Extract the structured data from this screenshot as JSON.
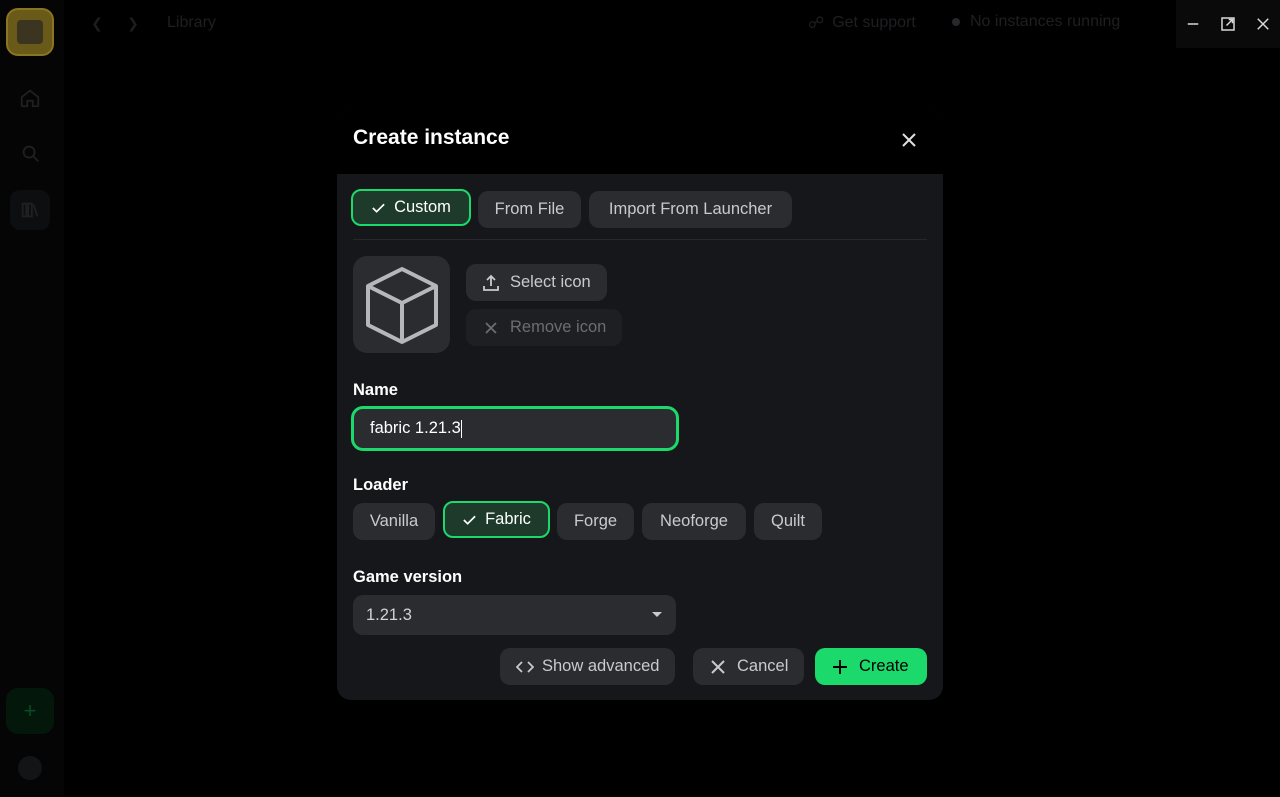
{
  "app": {
    "breadcrumb": "Library",
    "support_label": "Get support",
    "instances_status": "No instances running"
  },
  "modal": {
    "title": "Create instance",
    "tabs": [
      {
        "label": "Custom",
        "selected": true
      },
      {
        "label": "From File",
        "selected": false
      },
      {
        "label": "Import From Launcher",
        "selected": false
      }
    ],
    "icon": {
      "preview_icon": "cube-icon",
      "select_label": "Select icon",
      "remove_label": "Remove icon"
    },
    "name": {
      "label": "Name",
      "value": "fabric 1.21.3"
    },
    "loader": {
      "label": "Loader",
      "options": [
        {
          "label": "Vanilla",
          "selected": false
        },
        {
          "label": "Fabric",
          "selected": true
        },
        {
          "label": "Forge",
          "selected": false
        },
        {
          "label": "Neoforge",
          "selected": false
        },
        {
          "label": "Quilt",
          "selected": false
        }
      ]
    },
    "game_version": {
      "label": "Game version",
      "value": "1.21.3"
    },
    "actions": {
      "advanced_label": "Show advanced",
      "cancel_label": "Cancel",
      "create_label": "Create"
    }
  },
  "colors": {
    "accent": "#1bd96a",
    "modal_bg": "#16171a",
    "chip_bg": "#2a2c30"
  }
}
